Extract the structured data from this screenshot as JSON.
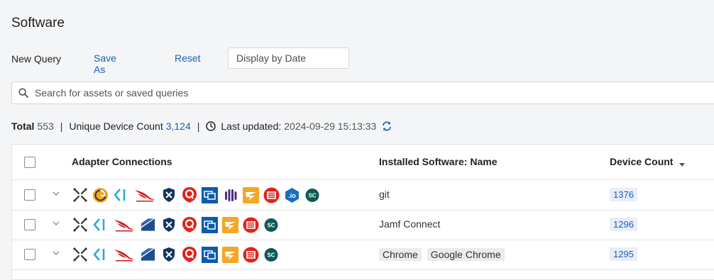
{
  "page": {
    "title": "Software"
  },
  "query_bar": {
    "new_query": "New Query",
    "save_as": "Save As",
    "reset": "Reset",
    "date_placeholder": "Display by Date"
  },
  "search": {
    "placeholder": "Search for assets or saved queries"
  },
  "summary": {
    "total_label": "Total",
    "total_value": "553",
    "unique_label": "Unique Device Count",
    "unique_value": "3,124",
    "updated_label": "Last updated:",
    "updated_value": "2024-09-29 15:13:33"
  },
  "table": {
    "columns": [
      "Adapter Connections",
      "Installed Software: Name",
      "Device Count"
    ],
    "rows": [
      {
        "adapters": [
          "x-icon",
          "spiral-icon",
          "bracket-icon",
          "crowdstrike-icon",
          "shield-icon",
          "q-icon",
          "monitor-icon",
          "bars-icon",
          "bolt-icon",
          "film-icon",
          "io-icon",
          "sc-icon"
        ],
        "software": [
          "git"
        ],
        "device_count": "1376"
      },
      {
        "adapters": [
          "x-icon",
          "bracket-icon",
          "crowdstrike-icon",
          "slash-icon",
          "shield-icon",
          "q-icon",
          "monitor-icon",
          "bolt-icon",
          "film-icon",
          "sc-icon"
        ],
        "software": [
          "Jamf Connect"
        ],
        "device_count": "1296"
      },
      {
        "adapters": [
          "x-icon",
          "bracket-icon",
          "crowdstrike-icon",
          "slash-icon",
          "shield-icon",
          "q-icon",
          "monitor-icon",
          "bolt-icon",
          "film-icon",
          "sc-icon"
        ],
        "software": [
          "Chrome",
          "Google Chrome"
        ],
        "device_count": "1295"
      }
    ]
  },
  "colors": {
    "link": "#1c5fb5",
    "qualys_red": "#e0231c",
    "monitor_blue": "#0b5cab",
    "bolt_orange": "#f5a623",
    "crowdstrike_red": "#d0181c",
    "sc_teal": "#0e5a55",
    "io_blue": "#1a6fc2",
    "bracket_cyan": "#2aa8de",
    "shield_navy": "#14365e",
    "slash_navy": "#1f4e8a",
    "bars_purple": "#4f2d7f"
  }
}
